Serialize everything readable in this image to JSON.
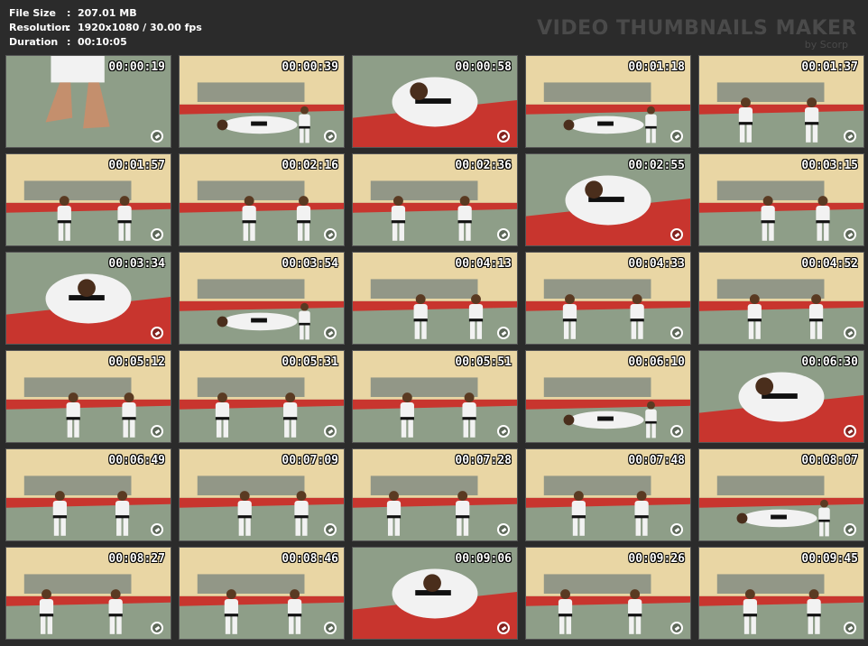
{
  "info": {
    "rows": [
      {
        "key": "File Size",
        "sep": ":",
        "value": "207.01 MB"
      },
      {
        "key": "Resolution",
        "sep": ":",
        "value": "1920x1080 / 30.00 fps"
      },
      {
        "key": "Duration",
        "sep": ":",
        "value": "00:10:05"
      }
    ]
  },
  "brand": {
    "title": "VIDEO THUMBNAILS MAKER",
    "subtitle": "by Scorp"
  },
  "colors": {
    "mat_green": "#8e9e88",
    "mat_red": "#c8352e",
    "wall": "#e9d6a4",
    "gi": "#f2f2f2"
  },
  "thumbs": [
    {
      "time": "00:00:19",
      "scene": "feet"
    },
    {
      "time": "00:00:39",
      "scene": "floor"
    },
    {
      "time": "00:00:58",
      "scene": "closeup"
    },
    {
      "time": "00:01:18",
      "scene": "floor"
    },
    {
      "time": "00:01:37",
      "scene": "two-standing"
    },
    {
      "time": "00:01:57",
      "scene": "two-standing"
    },
    {
      "time": "00:02:16",
      "scene": "two-standing"
    },
    {
      "time": "00:02:36",
      "scene": "two-standing"
    },
    {
      "time": "00:02:55",
      "scene": "closeup"
    },
    {
      "time": "00:03:15",
      "scene": "two-standing"
    },
    {
      "time": "00:03:34",
      "scene": "closeup"
    },
    {
      "time": "00:03:54",
      "scene": "floor"
    },
    {
      "time": "00:04:13",
      "scene": "two-standing"
    },
    {
      "time": "00:04:33",
      "scene": "two-standing"
    },
    {
      "time": "00:04:52",
      "scene": "two-standing"
    },
    {
      "time": "00:05:12",
      "scene": "two-standing"
    },
    {
      "time": "00:05:31",
      "scene": "two-standing"
    },
    {
      "time": "00:05:51",
      "scene": "two-standing"
    },
    {
      "time": "00:06:10",
      "scene": "floor"
    },
    {
      "time": "00:06:30",
      "scene": "closeup"
    },
    {
      "time": "00:06:49",
      "scene": "two-standing"
    },
    {
      "time": "00:07:09",
      "scene": "two-standing"
    },
    {
      "time": "00:07:28",
      "scene": "two-standing"
    },
    {
      "time": "00:07:48",
      "scene": "two-standing"
    },
    {
      "time": "00:08:07",
      "scene": "floor"
    },
    {
      "time": "00:08:27",
      "scene": "two-standing"
    },
    {
      "time": "00:08:46",
      "scene": "two-standing"
    },
    {
      "time": "00:09:06",
      "scene": "closeup"
    },
    {
      "time": "00:09:26",
      "scene": "two-standing"
    },
    {
      "time": "00:09:45",
      "scene": "two-standing"
    }
  ]
}
